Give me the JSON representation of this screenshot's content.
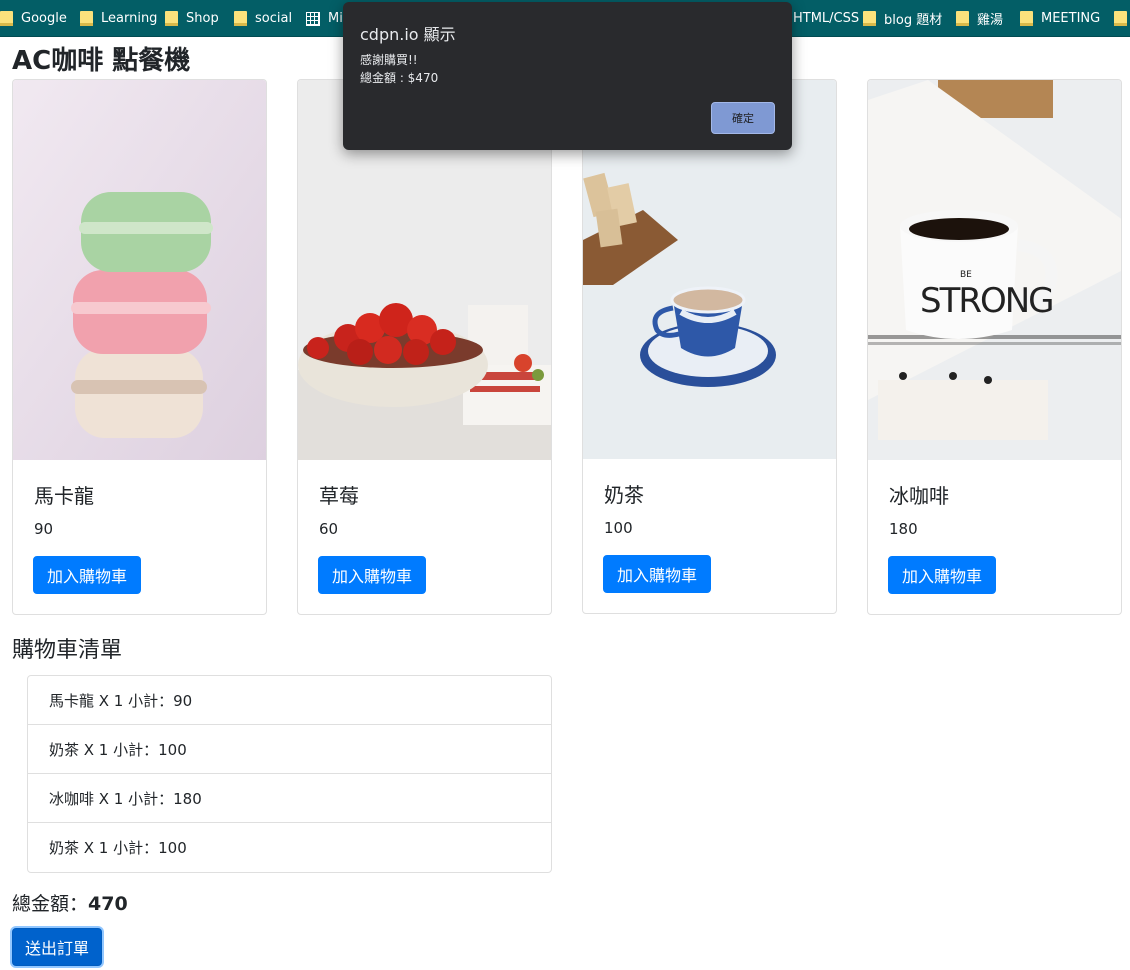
{
  "bookmarks": [
    {
      "label": "Google",
      "icon": "folder-icon"
    },
    {
      "label": "Learning",
      "icon": "folder-icon"
    },
    {
      "label": "Shop",
      "icon": "folder-icon"
    },
    {
      "label": "social",
      "icon": "folder-icon"
    },
    {
      "label": "Mi",
      "icon": "apps-grid-icon"
    },
    {
      "label": "HTML/CSS",
      "icon": "folder-icon"
    },
    {
      "label": "blog 題材",
      "icon": "folder-icon"
    },
    {
      "label": "雞湯",
      "icon": "folder-icon"
    },
    {
      "label": "MEETING",
      "icon": "folder-icon"
    }
  ],
  "page": {
    "title": "AC咖啡 點餐機"
  },
  "products": [
    {
      "name": "馬卡龍",
      "price": "90",
      "button": "加入購物車",
      "image": "macarons-photo"
    },
    {
      "name": "草莓",
      "price": "60",
      "button": "加入購物車",
      "image": "strawberries-photo"
    },
    {
      "name": "奶茶",
      "price": "100",
      "button": "加入購物車",
      "image": "milk-tea-photo"
    },
    {
      "name": "冰咖啡",
      "price": "180",
      "button": "加入購物車",
      "image": "iced-coffee-photo"
    }
  ],
  "cart": {
    "title": "購物車清單",
    "items": [
      "馬卡龍 X 1 小計：90",
      "奶茶 X 1 小計：100",
      "冰咖啡 X 1 小計：180",
      "奶茶 X 1 小計：100"
    ],
    "total_label": "總金額：",
    "total_value": "470",
    "submit_label": "送出訂單"
  },
  "dialog": {
    "title": "cdpn.io 顯示",
    "message_line1": "感謝購買!!",
    "message_line2": "總金額 : $470",
    "ok_label": "確定"
  },
  "colors": {
    "bookmarks_bar": "#035e66",
    "primary": "#007bff",
    "dialog_bg": "#292a2d"
  }
}
